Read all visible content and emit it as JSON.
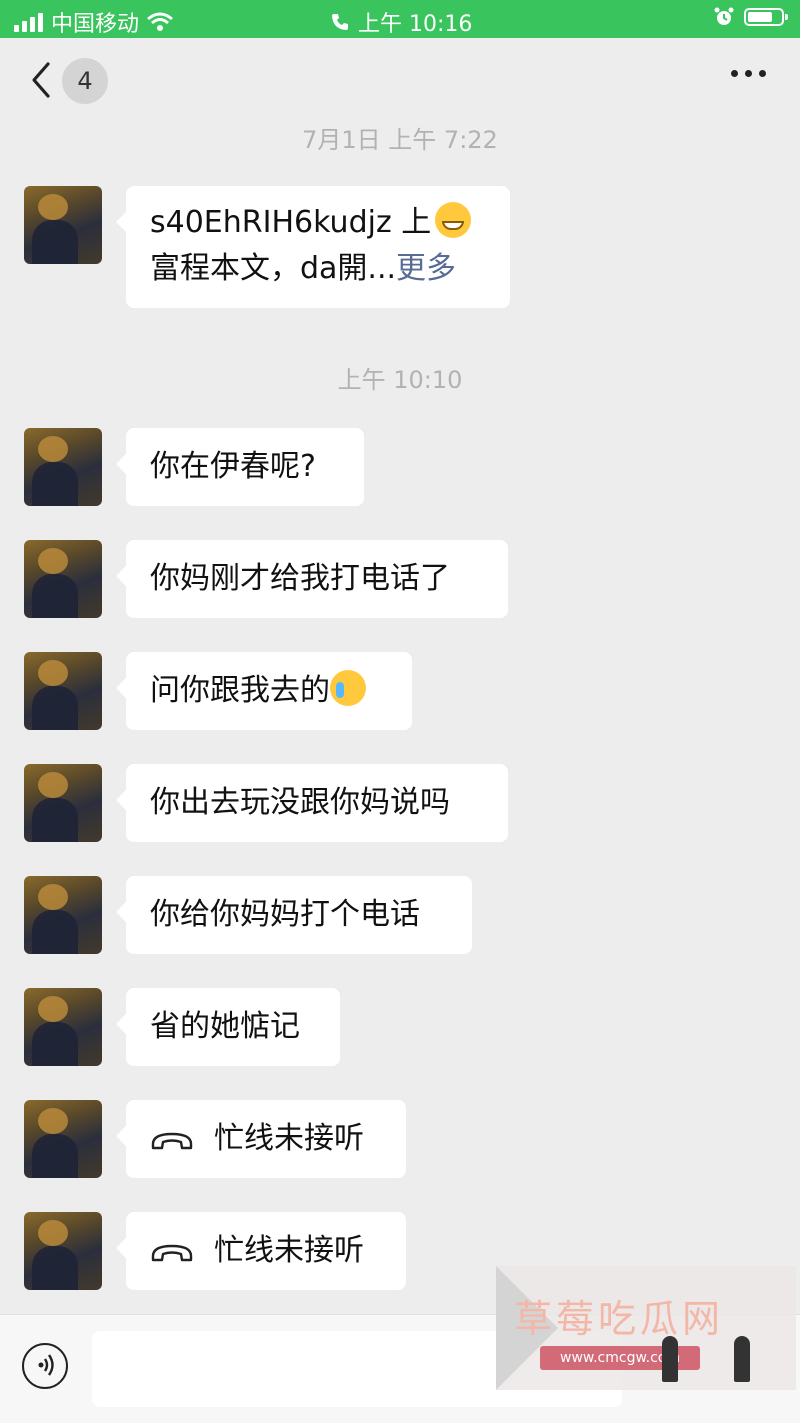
{
  "status_bar": {
    "carrier": "中国移动",
    "time": "上午 10:16"
  },
  "nav": {
    "unread_count": "4"
  },
  "chat": {
    "timestamps": [
      "7月1日 上午 7:22",
      "上午 10:10"
    ],
    "messages": [
      {
        "line1": "s40EhRIH6kudjz 上",
        "line2": "富程本文，da開...",
        "more": "更多",
        "emoji": "grinning-emoji"
      },
      {
        "text": "你在伊春呢?"
      },
      {
        "text": "你妈刚才给我打电话了"
      },
      {
        "text": "问你跟我去的",
        "emoji": "crying-laughing-emoji"
      },
      {
        "text": "你出去玩没跟你妈说吗"
      },
      {
        "text": "你给你妈妈打个电话"
      },
      {
        "text": "省的她惦记"
      },
      {
        "text": "忙线未接听",
        "icon": "missed-call-icon"
      },
      {
        "text": "忙线未接听",
        "icon": "missed-call-icon"
      }
    ]
  },
  "watermark": {
    "title": "草莓吃瓜网",
    "url": "www.cmcgw.com"
  },
  "colors": {
    "status_bar": "#39c45d",
    "background": "#ededed",
    "link": "#576b95"
  }
}
